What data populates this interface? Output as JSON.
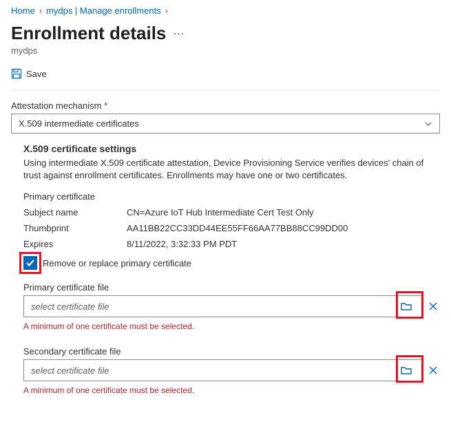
{
  "breadcrumb": {
    "home": "Home",
    "path": "mydps | Manage enrollments"
  },
  "page": {
    "title": "Enrollment details",
    "subtitle": "mydps"
  },
  "toolbar": {
    "save_label": "Save"
  },
  "form": {
    "attestation_label": "Attestation mechanism",
    "attestation_value": "X.509 intermediate certificates"
  },
  "x509": {
    "heading": "X.509 certificate settings",
    "description": "Using intermediate X.509 certificate attestation, Device Provisioning Service verifies devices' chain of trust against enrollment certificates. Enrollments may have one or two certificates.",
    "primary_label": "Primary certificate",
    "fields": {
      "subject_label": "Subject name",
      "subject_value": "CN=Azure IoT Hub Intermediate Cert Test Only",
      "thumbprint_label": "Thumbprint",
      "thumbprint_value": "AA11BB22CC33DD44EE55FF66AA77BB88CC99DD00",
      "expires_label": "Expires",
      "expires_value": "8/11/2022, 3:32:33 PM PDT"
    },
    "remove_replace_label": "Remove or replace primary certificate",
    "primary_file_label": "Primary certificate file",
    "secondary_file_label": "Secondary certificate file",
    "file_placeholder": "select certificate file",
    "error_msg": "A minimum of one certificate must be selected."
  }
}
